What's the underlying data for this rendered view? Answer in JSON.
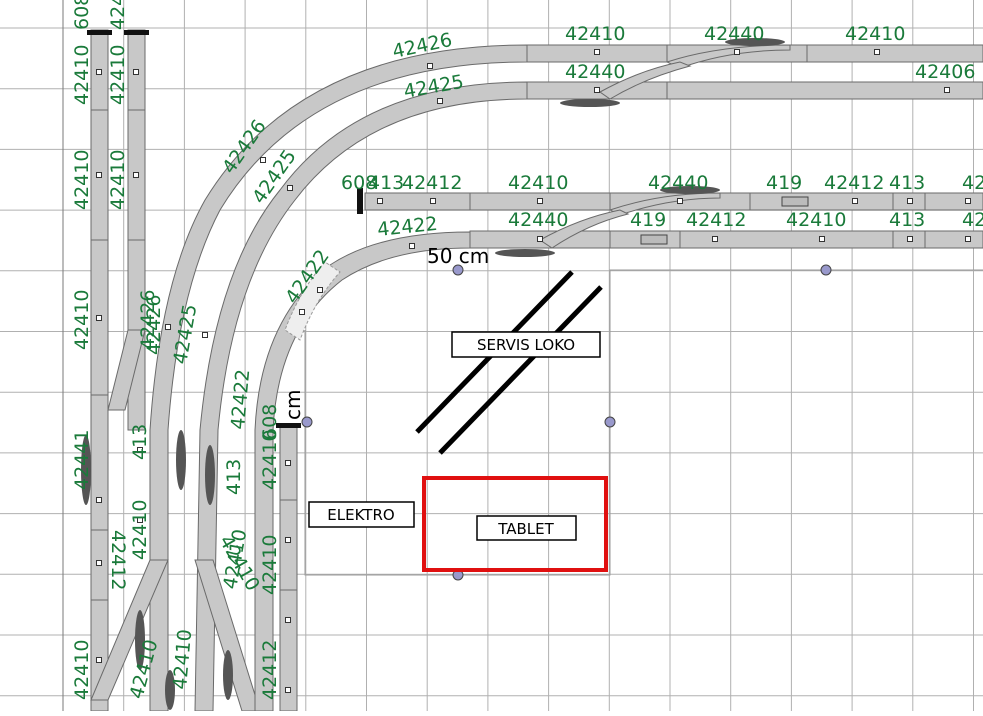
{
  "labels": {
    "servis": "SERVIS LOKO",
    "elektro": "ELEKTRO",
    "tablet": "TABLET",
    "dim_top": "50 cm",
    "dim_left": "cm"
  },
  "track_codes": {
    "top_row_1": [
      "42426",
      "42410",
      "42440",
      "42410"
    ],
    "top_row_2": [
      "42425",
      "42440",
      "42406"
    ],
    "middle_row_1": [
      "608",
      "413",
      "42412",
      "42410",
      "42440",
      "419",
      "42412",
      "413",
      "42"
    ],
    "middle_row_2": [
      "42422",
      "42440",
      "419",
      "42412",
      "42410",
      "413",
      "42"
    ],
    "left_verticals": [
      "42410",
      "42410",
      "42410",
      "42410",
      "42441",
      "42410",
      "608",
      "42410",
      "413",
      "42412",
      "42410",
      "42410",
      "42412"
    ],
    "left_curves": [
      "42426",
      "42425",
      "42425",
      "42422",
      "42422",
      "413",
      "42410",
      "42410",
      "42410",
      "42410",
      "608"
    ],
    "misc": [
      "42426",
      "42426",
      "42421",
      "42410"
    ]
  },
  "colors": {
    "track_label": "#1a7a3a",
    "highlight": "#e01010",
    "grid": "#b0b0b0"
  }
}
